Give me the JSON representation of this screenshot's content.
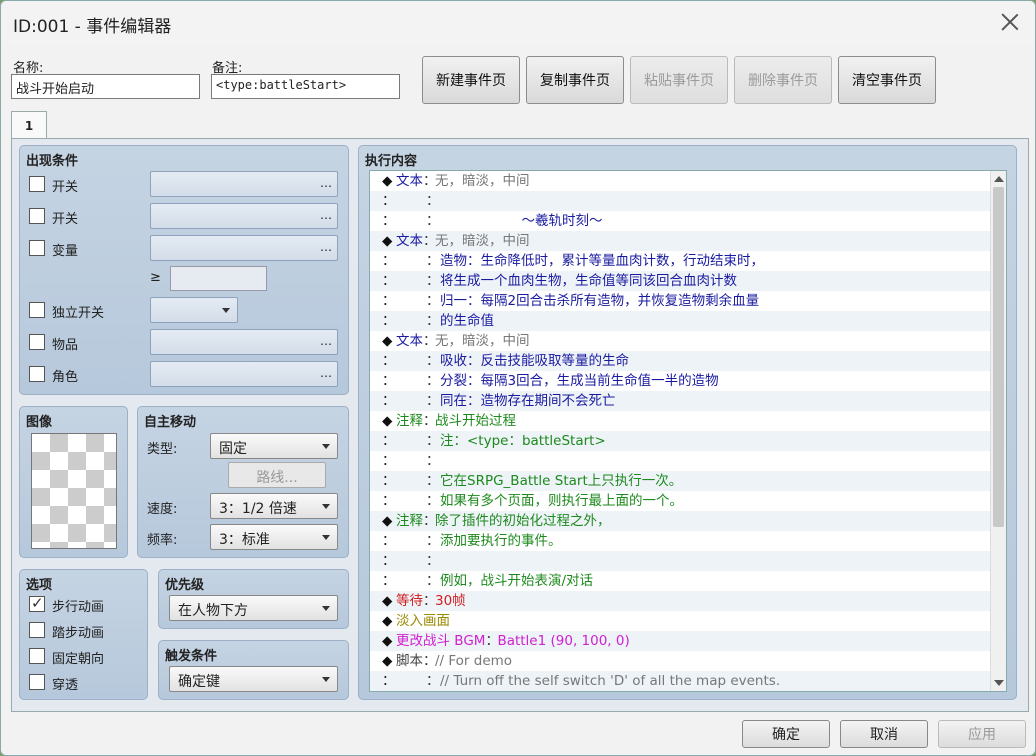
{
  "window": {
    "title": "ID:001 - 事件编辑器"
  },
  "header": {
    "name_label": "名称:",
    "name_value": "战斗开始启动",
    "note_label": "备注:",
    "note_value": "<type:battleStart>"
  },
  "page_buttons": {
    "new": "新建事件页",
    "copy": "复制事件页",
    "paste": "粘贴事件页",
    "delete": "删除事件页",
    "clear": "清空事件页"
  },
  "tab": {
    "label": "1"
  },
  "conditions": {
    "title": "出现条件",
    "switch1": "开关",
    "switch2": "开关",
    "variable": "变量",
    "ge": "≥",
    "self_switch": "独立开关",
    "item": "物品",
    "actor": "角色",
    "dots": "…"
  },
  "image": {
    "title": "图像"
  },
  "autonomous": {
    "title": "自主移动",
    "type_label": "类型:",
    "type_value": "固定",
    "route": "路线...",
    "speed_label": "速度:",
    "speed_value": "3：1/2 倍速",
    "freq_label": "频率:",
    "freq_value": "3：标准"
  },
  "options": {
    "title": "选项",
    "walk": "步行动画",
    "step": "踏步动画",
    "dir_fix": "固定朝向",
    "through": "穿透"
  },
  "priority": {
    "title": "优先级",
    "value": "在人物下方"
  },
  "trigger": {
    "title": "触发条件",
    "value": "确定键"
  },
  "contents": {
    "title": "执行内容",
    "rows": [
      {
        "h": "◆",
        "k": "文本",
        "kc": "#1a1aa0",
        "s": "：",
        "t": "无，暗淡，中间",
        "tc": "#777"
      },
      {
        "h": "：",
        "k": "",
        "kc": "",
        "s": "：",
        "t": "",
        "tc": "#222"
      },
      {
        "h": "：",
        "k": "",
        "kc": "",
        "s": "：",
        "t": "                   ～羲轨时刻～",
        "tc": "#1a1aa0"
      },
      {
        "h": "◆",
        "k": "文本",
        "kc": "#1a1aa0",
        "s": "：",
        "t": "无，暗淡，中间",
        "tc": "#777"
      },
      {
        "h": "：",
        "k": "",
        "kc": "",
        "s": "：",
        "t": "造物：生命降低时，累计等量血肉计数，行动结束时，",
        "tc": "#1a1aa0"
      },
      {
        "h": "：",
        "k": "",
        "kc": "",
        "s": "：",
        "t": "将生成一个血肉生物，生命值等同该回合血肉计数",
        "tc": "#1a1aa0"
      },
      {
        "h": "：",
        "k": "",
        "kc": "",
        "s": "：",
        "t": "归一：每隔2回合击杀所有造物，并恢复造物剩余血量",
        "tc": "#1a1aa0"
      },
      {
        "h": "：",
        "k": "",
        "kc": "",
        "s": "：",
        "t": "的生命值",
        "tc": "#1a1aa0"
      },
      {
        "h": "◆",
        "k": "文本",
        "kc": "#1a1aa0",
        "s": "：",
        "t": "无，暗淡，中间",
        "tc": "#777"
      },
      {
        "h": "：",
        "k": "",
        "kc": "",
        "s": "：",
        "t": "吸收：反击技能吸取等量的生命",
        "tc": "#1a1aa0"
      },
      {
        "h": "：",
        "k": "",
        "kc": "",
        "s": "：",
        "t": "分裂：每隔3回合，生成当前生命值一半的造物",
        "tc": "#1a1aa0"
      },
      {
        "h": "：",
        "k": "",
        "kc": "",
        "s": "：",
        "t": "同在：造物存在期间不会死亡",
        "tc": "#1a1aa0"
      },
      {
        "h": "◆",
        "k": "注释",
        "kc": "#1d8a1d",
        "s": "：",
        "t": "战斗开始过程",
        "tc": "#1d8a1d"
      },
      {
        "h": "：",
        "k": "",
        "kc": "",
        "s": "：",
        "t": "注：<type：battleStart>",
        "tc": "#1d8a1d"
      },
      {
        "h": "：",
        "k": "",
        "kc": "",
        "s": "：",
        "t": "",
        "tc": "#1d8a1d"
      },
      {
        "h": "：",
        "k": "",
        "kc": "",
        "s": "：",
        "t": "它在SRPG_Battle Start上只执行一次。",
        "tc": "#1d8a1d"
      },
      {
        "h": "：",
        "k": "",
        "kc": "",
        "s": "：",
        "t": "如果有多个页面，则执行最上面的一个。",
        "tc": "#1d8a1d"
      },
      {
        "h": "◆",
        "k": "注释",
        "kc": "#1d8a1d",
        "s": "：",
        "t": "除了插件的初始化过程之外，",
        "tc": "#1d8a1d"
      },
      {
        "h": "：",
        "k": "",
        "kc": "",
        "s": "：",
        "t": "添加要执行的事件。",
        "tc": "#1d8a1d"
      },
      {
        "h": "：",
        "k": "",
        "kc": "",
        "s": "：",
        "t": "",
        "tc": "#1d8a1d"
      },
      {
        "h": "：",
        "k": "",
        "kc": "",
        "s": "：",
        "t": "例如，战斗开始表演/对话",
        "tc": "#1d8a1d"
      },
      {
        "h": "◆",
        "k": "等待",
        "kc": "#d02020",
        "s": "：",
        "t": "30帧",
        "tc": "#d02020"
      },
      {
        "h": "◆",
        "k": "淡入画面",
        "kc": "#9a8a00",
        "s": "",
        "t": "",
        "tc": "#9a8a00"
      },
      {
        "h": "◆",
        "k": "更改战斗 BGM",
        "kc": "#d020d0",
        "s": "：",
        "t": "Battle1 (90, 100, 0)",
        "tc": "#d020d0"
      },
      {
        "h": "◆",
        "k": "脚本",
        "kc": "#444",
        "s": "：",
        "t": "// For demo",
        "tc": "#777"
      },
      {
        "h": "：",
        "k": "",
        "kc": "",
        "s": "：",
        "t": "// Turn off the self switch 'D' of all the map events.",
        "tc": "#777"
      }
    ]
  },
  "footer": {
    "ok": "确定",
    "cancel": "取消",
    "apply": "应用"
  }
}
